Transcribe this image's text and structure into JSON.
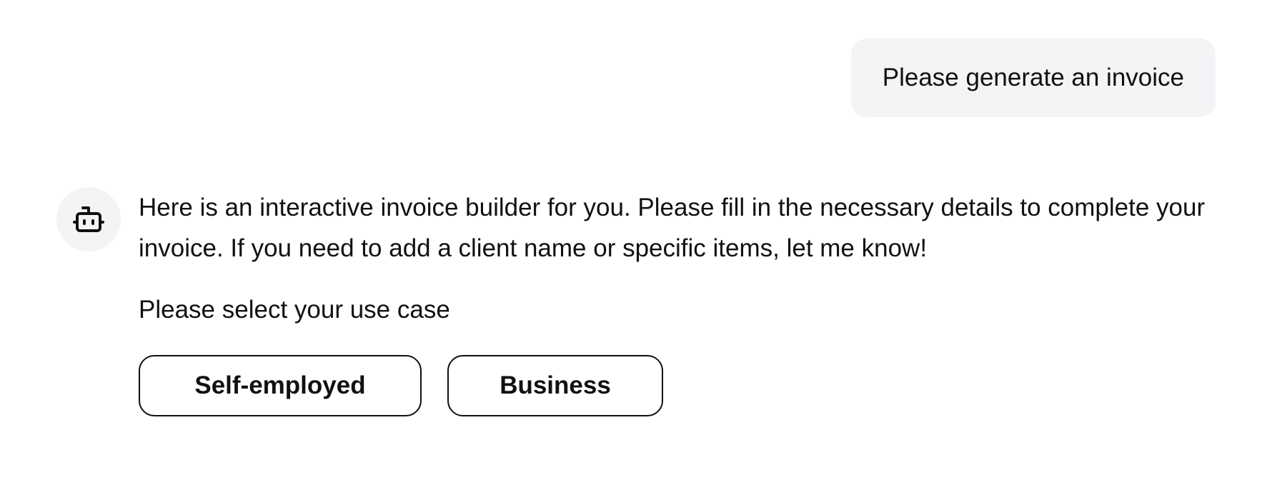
{
  "user_message": {
    "text": "Please generate an invoice"
  },
  "assistant_message": {
    "avatar_icon": "robot-icon",
    "text": "Here is an interactive invoice builder for you. Please fill in the necessary details to complete your invoice. If you need to add a client name or specific items, let me know!",
    "prompt": "Please select your use case",
    "options": [
      {
        "label": "Self-employed"
      },
      {
        "label": "Business"
      }
    ]
  },
  "colors": {
    "bubble_background": "#f3f4f6",
    "text": "#111111",
    "button_border": "#111111"
  }
}
